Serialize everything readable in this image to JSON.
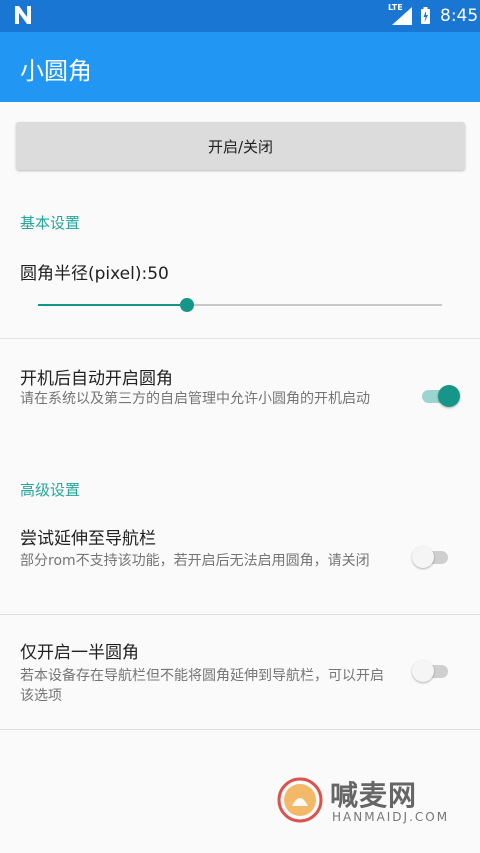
{
  "status_bar": {
    "lte": "LTE",
    "time": "8:45",
    "icons": [
      "notification-n-icon",
      "signal-icon",
      "battery-icon"
    ]
  },
  "app_bar": {
    "title": "小圆角"
  },
  "toggle_button": {
    "label": "开启/关闭"
  },
  "basic_settings": {
    "header": "基本设置",
    "radius_label": "圆角半径(pixel):50",
    "radius_slider_fraction": 0.37,
    "auto_start": {
      "title": "开机后自动开启圆角",
      "summary": "请在系统以及第三方的自启管理中允许小圆角的开机启动",
      "enabled": true
    }
  },
  "advanced_settings": {
    "header": "高级设置",
    "extend_nav": {
      "title": "尝试延伸至导航栏",
      "summary": "部分rom不支持该功能，若开启后无法启用圆角，请关闭",
      "enabled": false
    },
    "half_corner": {
      "title": "仅开启一半圆角",
      "summary": "若本设备存在导航栏但不能将圆角延伸到导航栏，可以开启该选项",
      "enabled": false
    }
  },
  "watermark": {
    "text": "喊麦网",
    "sub": "HANMAIDJ.COM"
  },
  "colors": {
    "status_bar": "#1976d2",
    "app_bar": "#2196f3",
    "accent": "#159688",
    "section_header": "#26a69a"
  }
}
